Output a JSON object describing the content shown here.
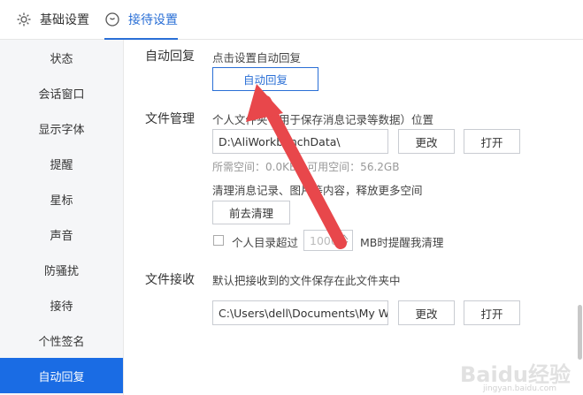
{
  "tabs": [
    {
      "label": "基础设置",
      "icon": "gear-icon"
    },
    {
      "label": "接待设置",
      "icon": "clock-icon",
      "active": true
    }
  ],
  "sidebar": {
    "items": [
      {
        "label": "状态"
      },
      {
        "label": "会话窗口"
      },
      {
        "label": "显示字体"
      },
      {
        "label": "提醒"
      },
      {
        "label": "星标"
      },
      {
        "label": "声音"
      },
      {
        "label": "防骚扰"
      },
      {
        "label": "接待"
      },
      {
        "label": "个性签名"
      },
      {
        "label": "自动回复",
        "active": true
      }
    ]
  },
  "auto_reply": {
    "title": "自动回复",
    "hint": "点击设置自动回复",
    "button": "自动回复"
  },
  "file_management": {
    "title": "文件管理",
    "desc": "个人文件夹（用于保存消息记录等数据）位置",
    "path": "D:\\AliWorkbenchData\\",
    "change_button": "更改",
    "open_button": "打开",
    "space_info": "所需空间：0.0KB，可用空间：56.2GB",
    "cleanup_desc": "清理消息记录、图片等内容，释放更多空间",
    "cleanup_button": "前去清理",
    "remind_prefix": "个人目录超过",
    "remind_value": "1000",
    "remind_suffix": "MB时提醒我清理"
  },
  "file_receive": {
    "title": "文件接收",
    "desc": "默认把接收到的文件保存在此文件夹中",
    "path": "C:\\Users\\dell\\Documents\\My W",
    "change_button": "更改",
    "open_button": "打开"
  },
  "watermark": {
    "text": "Baidu经验",
    "sub": "jingyan.baidu.com"
  },
  "colors": {
    "accent": "#1a6ce4",
    "arrow": "#e8474b"
  }
}
